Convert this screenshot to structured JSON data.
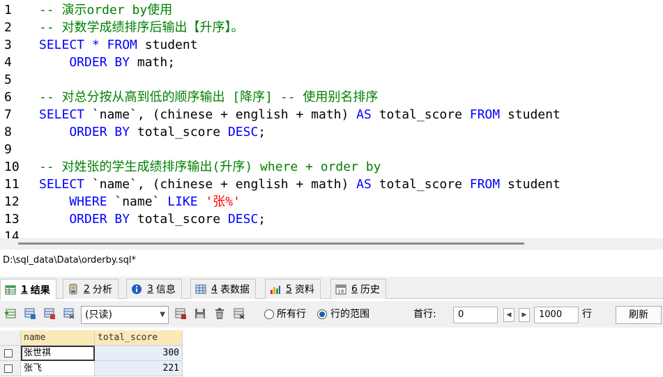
{
  "editor": {
    "lines": [
      {
        "num": "1",
        "tokens": [
          {
            "t": "-- 演示order by使用",
            "c": "comment"
          }
        ]
      },
      {
        "num": "2",
        "tokens": [
          {
            "t": "-- 对数学成绩排序后输出【升序】。",
            "c": "comment"
          }
        ]
      },
      {
        "num": "3",
        "tokens": [
          {
            "t": "SELECT * FROM",
            "c": "keyword"
          },
          {
            "t": " student",
            "c": "plain"
          }
        ]
      },
      {
        "num": "4",
        "tokens": [
          {
            "t": "    ORDER BY",
            "c": "keyword"
          },
          {
            "t": " math;",
            "c": "plain"
          }
        ]
      },
      {
        "num": "5",
        "tokens": []
      },
      {
        "num": "6",
        "tokens": [
          {
            "t": "-- 对总分按从高到低的顺序输出 [降序] -- 使用别名排序",
            "c": "comment"
          }
        ]
      },
      {
        "num": "7",
        "tokens": [
          {
            "t": "SELECT",
            "c": "keyword"
          },
          {
            "t": " `name`, (chinese + english + math) ",
            "c": "plain"
          },
          {
            "t": "AS",
            "c": "keyword"
          },
          {
            "t": " total_score ",
            "c": "plain"
          },
          {
            "t": "FROM",
            "c": "keyword"
          },
          {
            "t": " student",
            "c": "plain"
          }
        ]
      },
      {
        "num": "8",
        "tokens": [
          {
            "t": "    ORDER BY",
            "c": "keyword"
          },
          {
            "t": " total_score ",
            "c": "plain"
          },
          {
            "t": "DESC",
            "c": "keyword"
          },
          {
            "t": ";",
            "c": "plain"
          }
        ]
      },
      {
        "num": "9",
        "tokens": []
      },
      {
        "num": "10",
        "tokens": [
          {
            "t": "-- 对姓张的学生成绩排序输出(升序) where + order by",
            "c": "comment"
          }
        ]
      },
      {
        "num": "11",
        "tokens": [
          {
            "t": "SELECT",
            "c": "keyword"
          },
          {
            "t": " `name`, (chinese + english + math) ",
            "c": "plain"
          },
          {
            "t": "AS",
            "c": "keyword"
          },
          {
            "t": " total_score ",
            "c": "plain"
          },
          {
            "t": "FROM",
            "c": "keyword"
          },
          {
            "t": " student",
            "c": "plain"
          }
        ]
      },
      {
        "num": "12",
        "tokens": [
          {
            "t": "    WHERE",
            "c": "keyword"
          },
          {
            "t": " `name` ",
            "c": "plain"
          },
          {
            "t": "LIKE",
            "c": "keyword"
          },
          {
            "t": " ",
            "c": "plain"
          },
          {
            "t": "'张%'",
            "c": "string"
          }
        ]
      },
      {
        "num": "13",
        "tokens": [
          {
            "t": "    ORDER BY",
            "c": "keyword"
          },
          {
            "t": " total_score ",
            "c": "plain"
          },
          {
            "t": "DESC",
            "c": "keyword"
          },
          {
            "t": ";",
            "c": "plain"
          }
        ]
      },
      {
        "num": "14",
        "tokens": []
      }
    ]
  },
  "file_path": "D:\\sql_data\\Data\\orderby.sql*",
  "tabs": [
    {
      "num": "1",
      "label": "结果",
      "icon": "result-grid-icon"
    },
    {
      "num": "2",
      "label": "分析",
      "icon": "profiler-icon"
    },
    {
      "num": "3",
      "label": "信息",
      "icon": "info-icon"
    },
    {
      "num": "4",
      "label": "表数据",
      "icon": "table-data-icon"
    },
    {
      "num": "5",
      "label": "资料",
      "icon": "info-chart-icon"
    },
    {
      "num": "6",
      "label": "历史",
      "icon": "history-calendar-icon"
    }
  ],
  "toolbar": {
    "readonly_value": "(只读)",
    "all_rows_label": "所有行",
    "range_label": "行的范围",
    "first_row_label": "首行:",
    "first_row_value": "0",
    "row_count_value": "1000",
    "rows_unit": "行",
    "refresh_label": "刷新"
  },
  "grid": {
    "columns": [
      "name",
      "total_score"
    ],
    "rows": [
      {
        "name": "张世祺",
        "total_score": "300"
      },
      {
        "name": "张飞",
        "total_score": "221"
      }
    ]
  },
  "colors": {
    "comment": "#008000",
    "keyword": "#0000ff",
    "string": "#ff0000",
    "header_bg": "#fbe9b8",
    "score_bg": "#e8eef8"
  }
}
